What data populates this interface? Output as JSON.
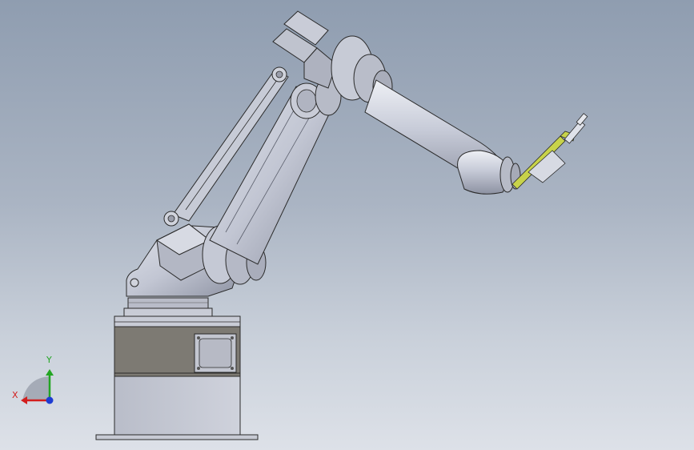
{
  "viewport": {
    "background_top": "#8f9db0",
    "background_bottom": "#dde1e8"
  },
  "triad": {
    "x_label": "X",
    "y_label": "Y",
    "x_color": "#d21e1e",
    "y_color": "#23a523",
    "z_color": "#1e3cd2"
  },
  "model": {
    "body_color": "#c3c7d4",
    "edge_color": "#2a2a2a",
    "base_band_color": "#7d7a73",
    "gripper_color": "#c8d34a"
  }
}
